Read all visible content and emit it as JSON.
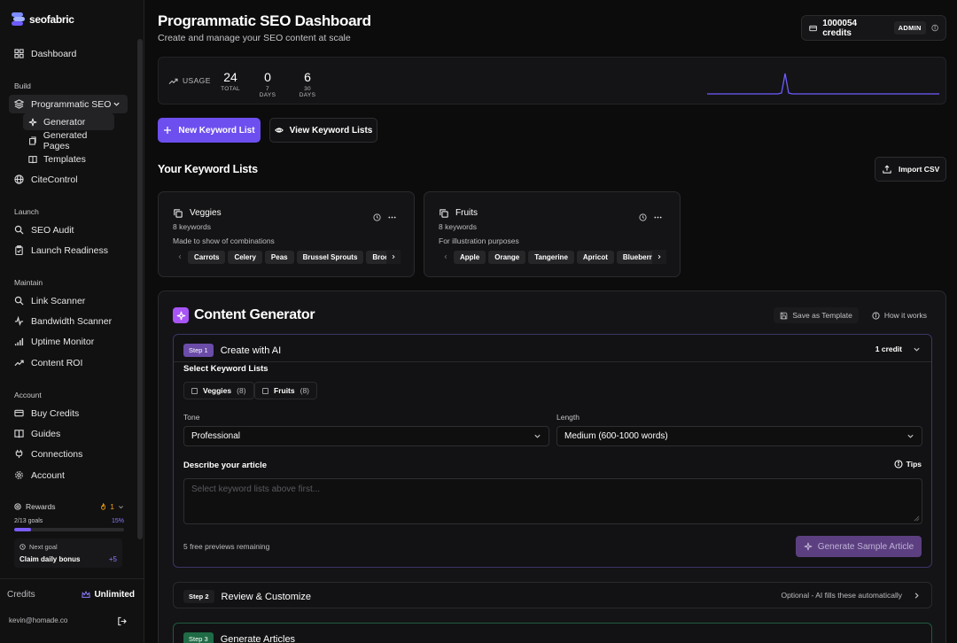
{
  "brand": {
    "name": "seofabric"
  },
  "sidebar": {
    "dashboard": "Dashboard",
    "sections": {
      "build": "Build",
      "launch": "Launch",
      "maintain": "Maintain",
      "account": "Account"
    },
    "programmatic_seo": "Programmatic SEO",
    "sub": {
      "generator": "Generator",
      "generated_pages": "Generated Pages",
      "templates": "Templates"
    },
    "citecontrol": "CiteControl",
    "seo_audit": "SEO Audit",
    "launch_readiness": "Launch Readiness",
    "link_scanner": "Link Scanner",
    "bandwidth_scanner": "Bandwidth Scanner",
    "uptime_monitor": "Uptime Monitor",
    "content_roi": "Content ROI",
    "buy_credits": "Buy Credits",
    "guides": "Guides",
    "connections": "Connections",
    "account_item": "Account",
    "rewards": {
      "title": "Rewards",
      "streak": "1",
      "goals": "2/13 goals",
      "percent": "15%",
      "progress": 0.15,
      "next_goal_label": "Next goal",
      "next_goal": "Claim daily bonus",
      "next_goal_reward": "+5"
    },
    "credits_label": "Credits",
    "credits_value": "Unlimited",
    "user_email": "kevin@homade.co"
  },
  "header": {
    "title": "Programmatic SEO Dashboard",
    "subtitle": "Create and manage your SEO content at scale",
    "credits": "1000054 credits",
    "role": "ADMIN"
  },
  "usage": {
    "label": "USAGE",
    "stats": [
      {
        "value": "24",
        "label": "TOTAL"
      },
      {
        "value": "0",
        "label": "7 DAYS"
      },
      {
        "value": "6",
        "label": "30 DAYS"
      }
    ]
  },
  "actions": {
    "new_list": "New Keyword List",
    "view_lists": "View Keyword Lists"
  },
  "keyword_lists": {
    "title": "Your Keyword Lists",
    "import": "Import CSV",
    "lists": [
      {
        "name": "Veggies",
        "count": "8 keywords",
        "description": "Made to show of combinations",
        "keywords": [
          "Carrots",
          "Celery",
          "Peas",
          "Brussel Sprouts",
          "Broc"
        ]
      },
      {
        "name": "Fruits",
        "count": "8 keywords",
        "description": "For illustration purposes",
        "keywords": [
          "Apple",
          "Orange",
          "Tangerine",
          "Apricot",
          "Blueberr"
        ]
      }
    ]
  },
  "generator": {
    "title": "Content Generator",
    "save_template": "Save as Template",
    "how_it_works": "How it works",
    "step1": {
      "badge": "Step 1",
      "name": "Create with AI",
      "cost": "1 credit",
      "select_label": "Select Keyword Lists",
      "lists": [
        {
          "name": "Veggies",
          "count": "(8)"
        },
        {
          "name": "Fruits",
          "count": "(8)"
        }
      ],
      "tone_label": "Tone",
      "tone_value": "Professional",
      "length_label": "Length",
      "length_value": "Medium (600-1000 words)",
      "describe_label": "Describe your article",
      "tips": "Tips",
      "placeholder": "Select keyword lists above first...",
      "previews": "5 free previews remaining",
      "generate": "Generate Sample Article"
    },
    "step2": {
      "badge": "Step 2",
      "name": "Review & Customize",
      "note": "Optional - AI fills these automatically"
    },
    "step3": {
      "badge": "Step 3",
      "name": "Generate Articles"
    }
  }
}
